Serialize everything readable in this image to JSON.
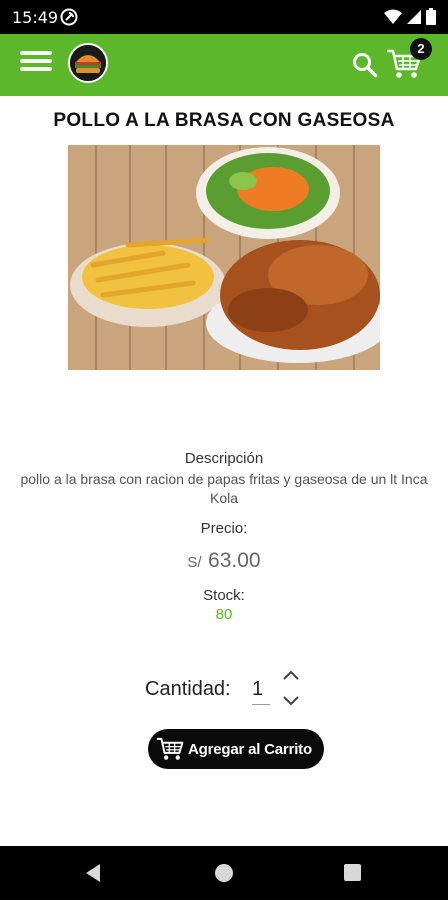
{
  "status_bar": {
    "time": "15:49"
  },
  "header": {
    "cart_count": "2"
  },
  "product": {
    "title": "POLLO A LA BRASA CON GASEOSA",
    "description_label": "Descripción",
    "description": "pollo a la brasa con racion de papas fritas y gaseosa de un lt Inca Kola",
    "price_label": "Precio:",
    "currency": "S/",
    "price": "63.00",
    "stock_label": "Stock:",
    "stock": "80"
  },
  "purchase": {
    "quantity_label": "Cantidad:",
    "quantity_value": "1",
    "add_to_cart_label": "Agregar al Carrito"
  },
  "colors": {
    "brand_green": "#5cb82a",
    "button_dark": "#0a0a0a"
  },
  "icons": [
    "menu-icon",
    "logo",
    "search-icon",
    "cart-icon",
    "stepper-up-icon",
    "stepper-down-icon",
    "cart-button-icon",
    "back-icon",
    "home-icon",
    "recent-apps-icon"
  ]
}
